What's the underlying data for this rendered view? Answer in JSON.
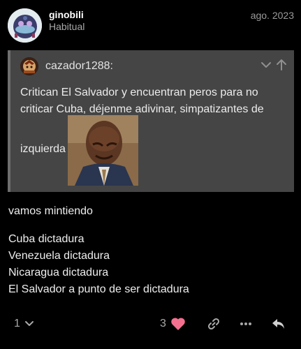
{
  "post": {
    "username": "ginobili",
    "user_title": "Habitual",
    "date": "ago. 2023"
  },
  "quote": {
    "username": "cazador1288:",
    "text_line1": "Critican El Salvador y encuentran peros para no criticar Cuba, déjenme adivinar, simpatizantes de",
    "text_line2": "izquierda"
  },
  "body": {
    "intro": "vamos mintiendo",
    "lines": [
      "Cuba dictadura",
      "Venezuela dictadura",
      "Nicaragua dictadura",
      "El Salvador a punto de ser dictadura"
    ]
  },
  "actions": {
    "replies_count": "1",
    "likes_count": "3"
  },
  "colors": {
    "heart": "#f5708f",
    "quote_bg": "#454545"
  }
}
